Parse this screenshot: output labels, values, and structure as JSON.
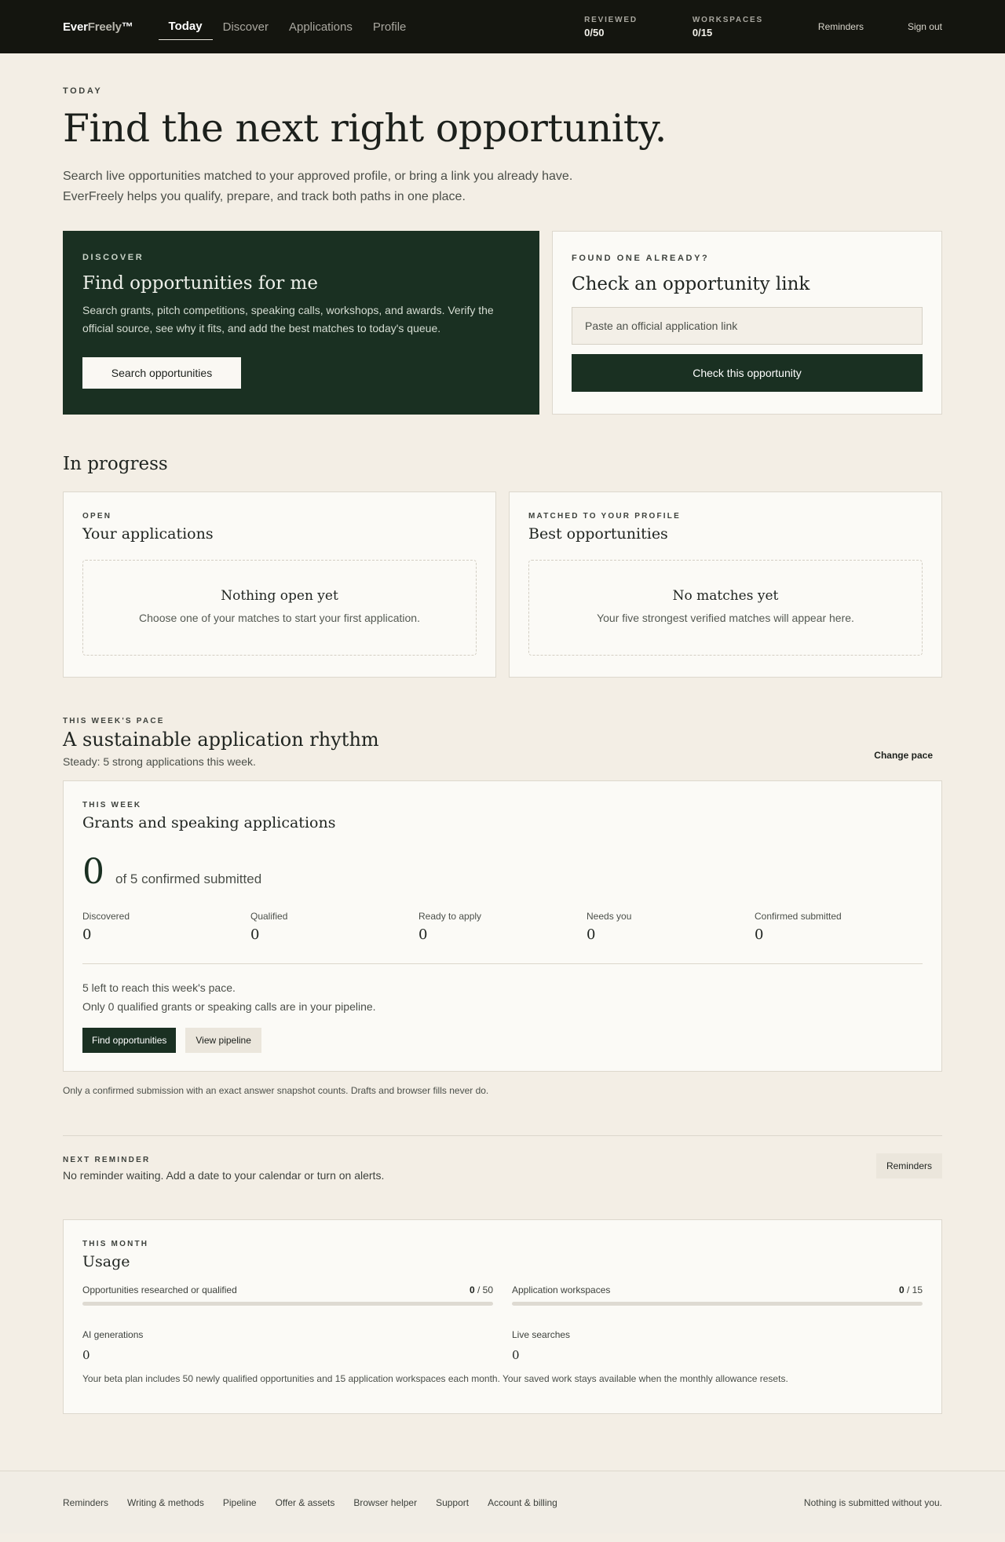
{
  "nav": {
    "brand_main": "Ever",
    "brand_soft": "Freely",
    "brand_mark": "™",
    "links": [
      "Today",
      "Discover",
      "Applications",
      "Profile"
    ],
    "stats": [
      {
        "label": "Reviewed",
        "value": "0/50"
      },
      {
        "label": "Workspaces",
        "value": "0/15"
      }
    ],
    "reminders": "Reminders",
    "sign_out": "Sign out"
  },
  "hero": {
    "eyebrow": "TODAY",
    "title": "Find the next right opportunity.",
    "line1": "Search live opportunities matched to your approved profile, or bring a link you already have.",
    "line2": "EverFreely helps you qualify, prepare, and track both paths in one place."
  },
  "discover": {
    "eyebrow": "DISCOVER",
    "title": "Find opportunities for me",
    "body": "Search grants, pitch competitions, speaking calls, workshops, and awards. Verify the official source, see why it fits, and add the best matches to today's queue.",
    "button": "Search opportunities"
  },
  "check": {
    "eyebrow": "FOUND ONE ALREADY?",
    "title": "Check an opportunity link",
    "placeholder": "Paste an official application link",
    "button": "Check this opportunity"
  },
  "in_progress": {
    "title": "In progress",
    "cards": [
      {
        "eyebrow": "OPEN",
        "title": "Your applications",
        "empty_title": "Nothing open yet",
        "empty_desc": "Choose one of your matches to start your first application."
      },
      {
        "eyebrow": "MATCHED TO YOUR PROFILE",
        "title": "Best opportunities",
        "empty_title": "No matches yet",
        "empty_desc": "Your five strongest verified matches will appear here."
      }
    ]
  },
  "pace": {
    "eyebrow": "THIS WEEK'S PACE",
    "title": "A sustainable application rhythm",
    "subtitle": "Steady: 5 strong applications this week.",
    "change": "Change pace",
    "card": {
      "eyebrow": "THIS WEEK",
      "title": "Grants and speaking applications",
      "count": "0",
      "count_label": "of 5 confirmed submitted",
      "stages": [
        {
          "label": "Discovered",
          "value": "0"
        },
        {
          "label": "Qualified",
          "value": "0"
        },
        {
          "label": "Ready to apply",
          "value": "0"
        },
        {
          "label": "Needs you",
          "value": "0"
        },
        {
          "label": "Confirmed submitted",
          "value": "0"
        }
      ],
      "note1": "5 left to reach this week's pace.",
      "note2": "Only 0 qualified grants or speaking calls are in your pipeline.",
      "btn_find": "Find opportunities",
      "btn_pipeline": "View pipeline"
    },
    "footnote": "Only a confirmed submission with an exact answer snapshot counts. Drafts and browser fills never do."
  },
  "reminder": {
    "eyebrow": "NEXT REMINDER",
    "text": "No reminder waiting. Add a date to your calendar or turn on alerts.",
    "button": "Reminders"
  },
  "usage": {
    "eyebrow": "THIS MONTH",
    "title": "Usage",
    "meters": [
      {
        "label": "Opportunities researched or qualified",
        "used": "0",
        "total": "/ 50",
        "fraction": 0
      },
      {
        "label": "Application workspaces",
        "used": "0",
        "total": "/ 15",
        "fraction": 0
      }
    ],
    "counters": [
      {
        "label": "AI generations",
        "value": "0"
      },
      {
        "label": "Live searches",
        "value": "0"
      }
    ],
    "note": "Your beta plan includes 50 newly qualified opportunities and 15 application workspaces each month. Your saved work stays available when the monthly allowance resets."
  },
  "footer": {
    "links": [
      "Reminders",
      "Writing & methods",
      "Pipeline",
      "Offer & assets",
      "Browser helper",
      "Support",
      "Account & billing"
    ],
    "tagline": "Nothing is submitted without you."
  }
}
